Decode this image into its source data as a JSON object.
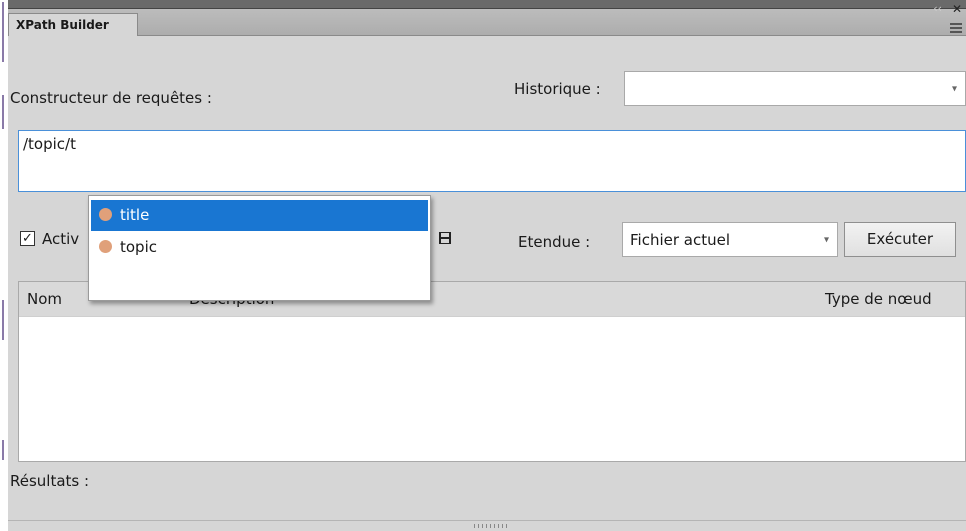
{
  "panel": {
    "tab_title": "XPath Builder"
  },
  "query_builder": {
    "label": "Constructeur de requêtes :",
    "history_label": "Historique :",
    "history_value": "",
    "query_text": "/topic/t"
  },
  "autocomplete": {
    "items": [
      {
        "label": "title",
        "selected": true
      },
      {
        "label": "topic",
        "selected": false
      }
    ]
  },
  "options": {
    "checkbox_label": "Activ",
    "checkbox_checked": true,
    "scope_label": "Etendue :",
    "scope_value": "Fichier actuel",
    "execute_label": "Exécuter"
  },
  "results": {
    "columns": [
      "Nom",
      "Description",
      "Type de nœud"
    ],
    "rows": [],
    "label": "Résultats :"
  },
  "colors": {
    "selection": "#1976d2",
    "query_border": "#4a90d9",
    "node_dot": "#e0a07a"
  }
}
